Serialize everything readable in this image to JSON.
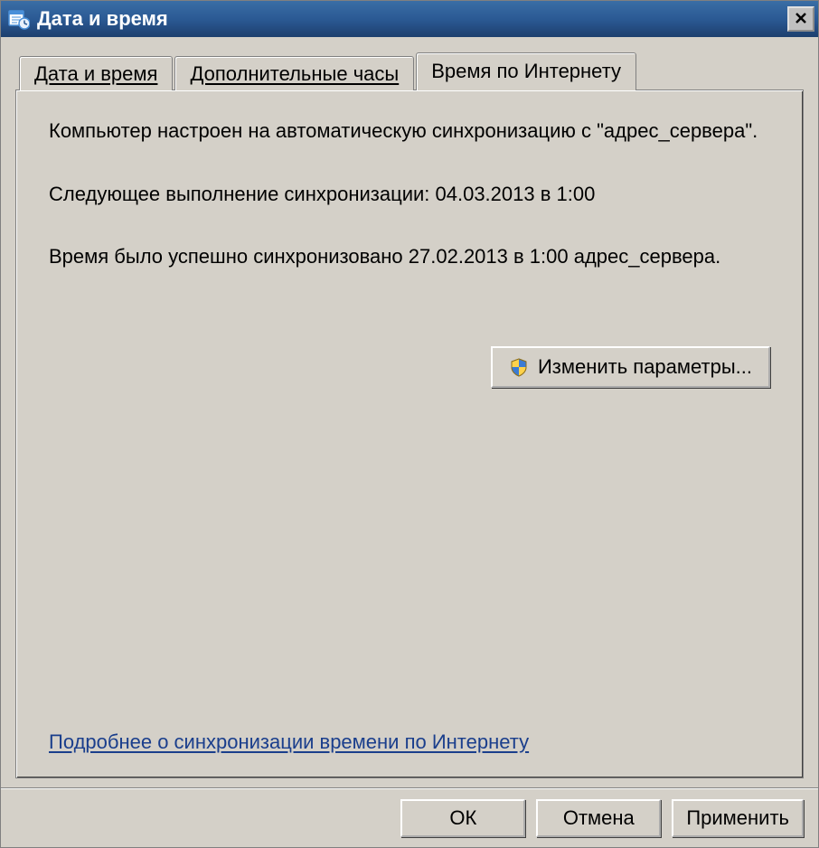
{
  "window": {
    "title": "Дата и время"
  },
  "tabs": [
    {
      "label": "Дата и время"
    },
    {
      "label": "Дополнительные часы"
    },
    {
      "label": "Время по Интернету"
    }
  ],
  "content": {
    "sync_configured": "Компьютер настроен на автоматическую синхронизацию с \"адрес_сервера\".",
    "next_sync": "Следующее выполнение синхронизации: 04.03.2013 в 1:00",
    "last_sync": "Время было успешно синхронизовано 27.02.2013 в 1:00 адрес_сервера.",
    "change_settings": "Изменить параметры...",
    "more_link": "Подробнее о синхронизации времени по Интернету"
  },
  "buttons": {
    "ok": "ОК",
    "cancel": "Отмена",
    "apply": "Применить"
  }
}
